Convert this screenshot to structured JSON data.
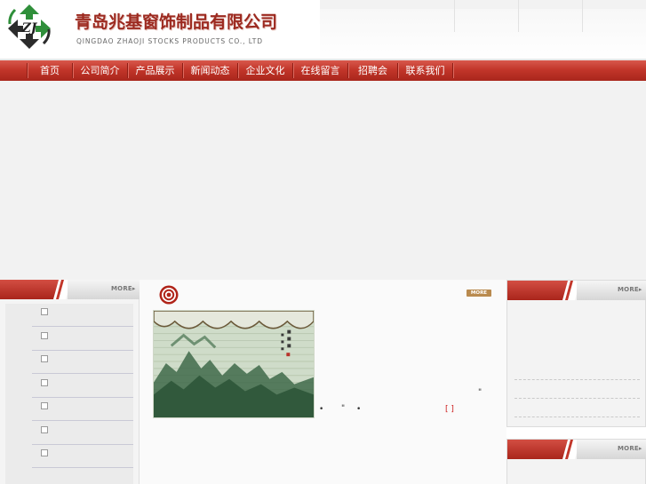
{
  "header": {
    "company_name": "青岛兆基窗饰制品有限公司",
    "company_name_en": "QINGDAO ZHAOJI STOCKS PRODUCTS CO., LTD",
    "logo_text": "ZJ",
    "colors": {
      "brand_red": "#c2362a",
      "logo_green": "#2f8f3a"
    }
  },
  "nav": {
    "items": [
      {
        "label": "首页"
      },
      {
        "label": "公司简介"
      },
      {
        "label": "产品展示"
      },
      {
        "label": "新闻动态"
      },
      {
        "label": "企业文化"
      },
      {
        "label": "在线留言"
      },
      {
        "label": "招聘会"
      },
      {
        "label": "联系我们"
      }
    ]
  },
  "left_panel": {
    "more_label": "MORE",
    "categories": [
      "",
      "",
      "",
      "",
      "",
      "",
      ""
    ]
  },
  "center": {
    "more_label": "MORE",
    "intro": {
      "quote_mark": "\"",
      "mark_a": "•",
      "mark_b": "\"",
      "mark_c": "•",
      "more_link": "[ ]"
    },
    "image_alt_icon": "landscape-painting-image"
  },
  "right_panel": {
    "more_label_1": "MORE",
    "more_label_2": "MORE"
  }
}
